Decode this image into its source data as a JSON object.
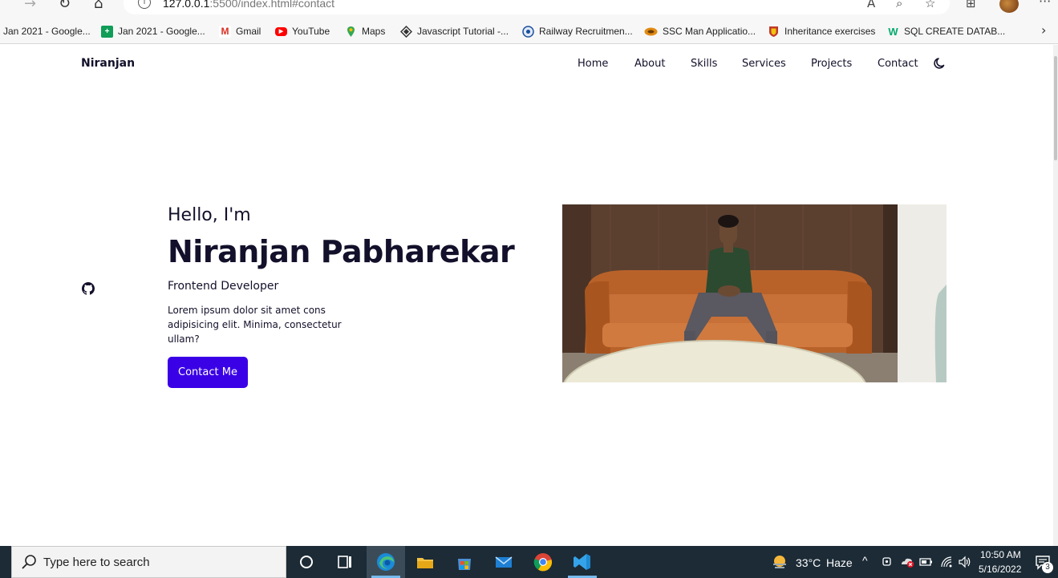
{
  "browser": {
    "address_host": "127.0.0.1",
    "address_rest": ":5500/index.html#contact",
    "bookmarks": [
      {
        "label": "Jan 2021 - Google...",
        "icon": "google-sheets-icon"
      },
      {
        "label": "Jan 2021 - Google...",
        "icon": "google-sheets-icon"
      },
      {
        "label": "Gmail",
        "icon": "gmail-icon"
      },
      {
        "label": "YouTube",
        "icon": "youtube-icon"
      },
      {
        "label": "Maps",
        "icon": "maps-pin-icon"
      },
      {
        "label": "Javascript Tutorial -...",
        "icon": "diamond-icon"
      },
      {
        "label": "Railway Recruitmen...",
        "icon": "railway-emblem-icon"
      },
      {
        "label": "SSC Man Applicatio...",
        "icon": "ssc-icon"
      },
      {
        "label": "Inheritance exercises",
        "icon": "shield-icon"
      },
      {
        "label": "SQL CREATE DATAB...",
        "icon": "w3schools-icon"
      }
    ]
  },
  "site": {
    "logo": "Niranjan",
    "nav": [
      "Home",
      "About",
      "Skills",
      "Services",
      "Projects",
      "Contact"
    ],
    "theme_icon": "moon-icon"
  },
  "hero": {
    "greeting": "Hello, I'm",
    "name": "Niranjan Pabharekar",
    "role": "Frontend Developer",
    "description": "Lorem ipsum dolor sit amet cons adipisicing elit. Minima, consectetur ullam?",
    "cta_label": "Contact Me",
    "social_icon": "github-icon"
  },
  "taskbar": {
    "search_placeholder": "Type here to search",
    "weather_temp": "33°C",
    "weather_text": "Haze",
    "time": "10:50 AM",
    "date": "5/16/2022",
    "notification_count": "3"
  },
  "colors": {
    "primary": "#3a00e6",
    "text_dark": "#12102a",
    "taskbar": "#1c2b36"
  }
}
